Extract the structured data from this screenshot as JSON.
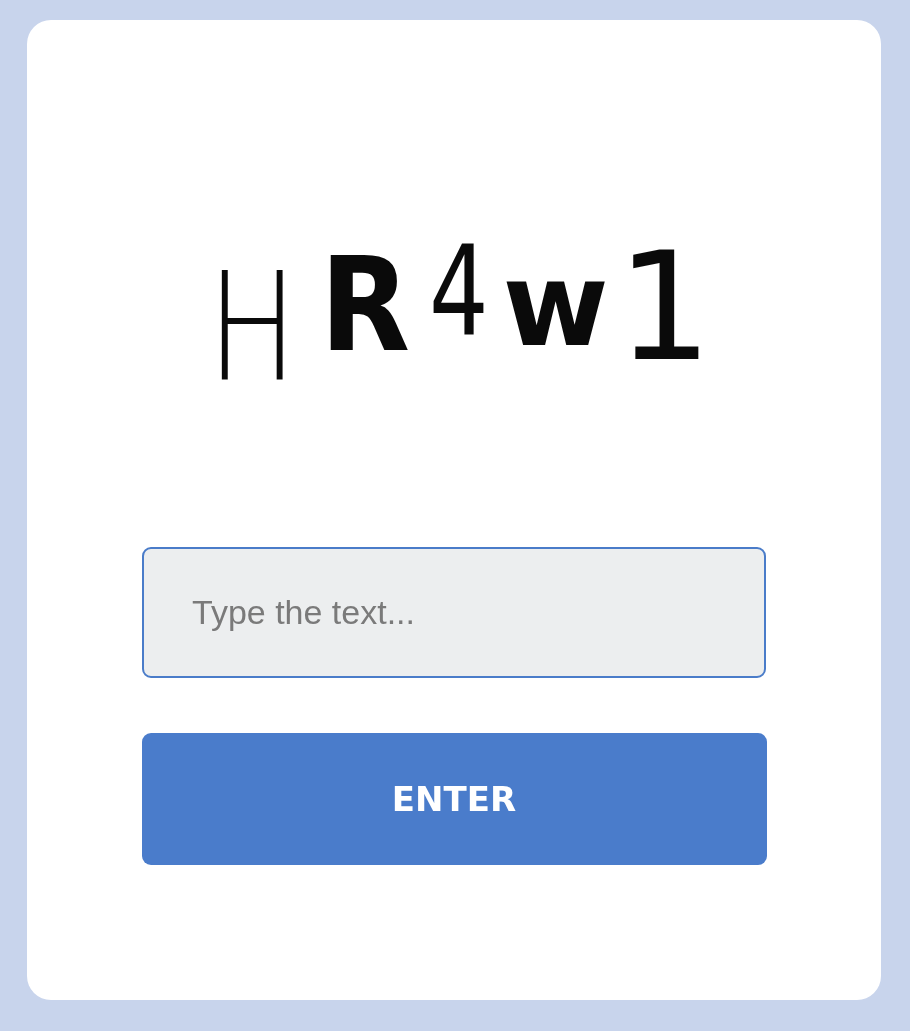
{
  "captcha": {
    "text": "HR4w1"
  },
  "answer": {
    "placeholder": "Type the text..."
  },
  "button": {
    "label": "ENTER"
  }
}
